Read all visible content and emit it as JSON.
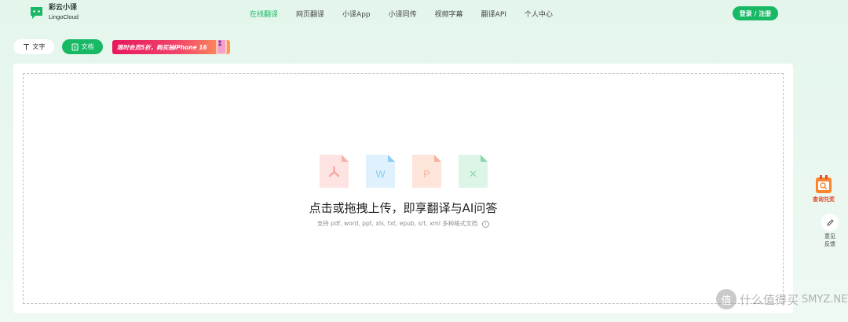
{
  "brand": {
    "name_cn": "彩云小译",
    "name_en": "LingoCloud"
  },
  "nav": {
    "items": [
      {
        "label": "在线翻译",
        "active": true
      },
      {
        "label": "网页翻译",
        "active": false
      },
      {
        "label": "小译App",
        "active": false
      },
      {
        "label": "小译同传",
        "active": false
      },
      {
        "label": "视频字幕",
        "active": false
      },
      {
        "label": "翻译API",
        "active": false
      },
      {
        "label": "个人中心",
        "active": false
      }
    ]
  },
  "header": {
    "login_label": "登录 / 注册"
  },
  "tabs": {
    "text_label": "文字",
    "doc_label": "文档"
  },
  "promo": {
    "label": "限时会员5折，购买抽iPhone 16"
  },
  "upload": {
    "title": "点击或拖拽上传，即享翻译与AI问答",
    "subtitle": "支持 pdf, word, ppt, xls, txt, epub, srt, xml 多种格式文档",
    "file_types": [
      {
        "kind": "pdf",
        "glyph": "",
        "color": "#f5b1ad",
        "bg": "#fde3e1"
      },
      {
        "kind": "word",
        "glyph": "W",
        "color": "#8ccdf3",
        "bg": "#dff1fc"
      },
      {
        "kind": "ppt",
        "glyph": "P",
        "color": "#f5b4a0",
        "bg": "#fde5dc"
      },
      {
        "kind": "excel",
        "glyph": "✕",
        "color": "#8ed8ad",
        "bg": "#ddf5e7"
      }
    ]
  },
  "side": {
    "vip_label": "查询兑奖",
    "feedback_label": "意见反馈"
  },
  "watermark": {
    "badge": "值",
    "text": "什么值得买",
    "site": "SMYZ.NET"
  },
  "colors": {
    "accent": "#18b865",
    "promo": "#e8165c"
  }
}
